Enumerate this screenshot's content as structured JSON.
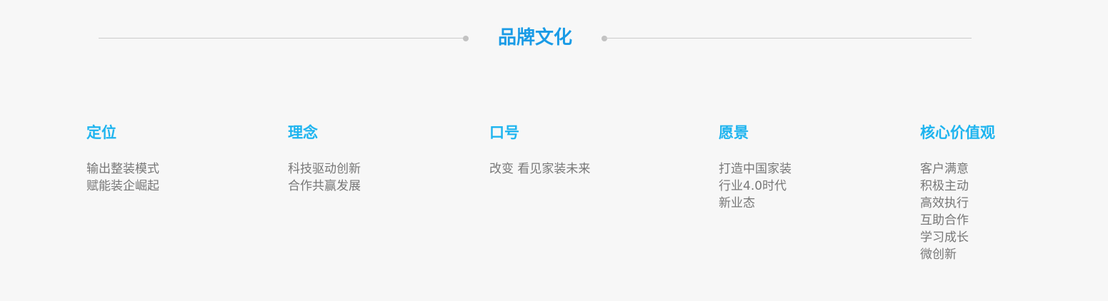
{
  "section": {
    "title": "品牌文化"
  },
  "columns": [
    {
      "heading": "定位",
      "lines": [
        "输出整装模式",
        "赋能装企崛起"
      ]
    },
    {
      "heading": "理念",
      "lines": [
        "科技驱动创新",
        "合作共赢发展"
      ]
    },
    {
      "heading": "口号",
      "lines": [
        "改变 看见家装未来"
      ]
    },
    {
      "heading": "愿景",
      "lines": [
        "打造中国家装",
        "行业4.0时代",
        "新业态"
      ]
    },
    {
      "heading": "核心价值观",
      "lines": [
        "客户满意",
        "积极主动",
        "高效执行",
        "互助合作",
        "学习成长",
        "微创新"
      ]
    }
  ],
  "colors": {
    "title": "#1a9be6",
    "heading": "#1eb4ef",
    "body_text": "#777777",
    "divider": "#cccccc",
    "background": "#f7f7f7"
  }
}
